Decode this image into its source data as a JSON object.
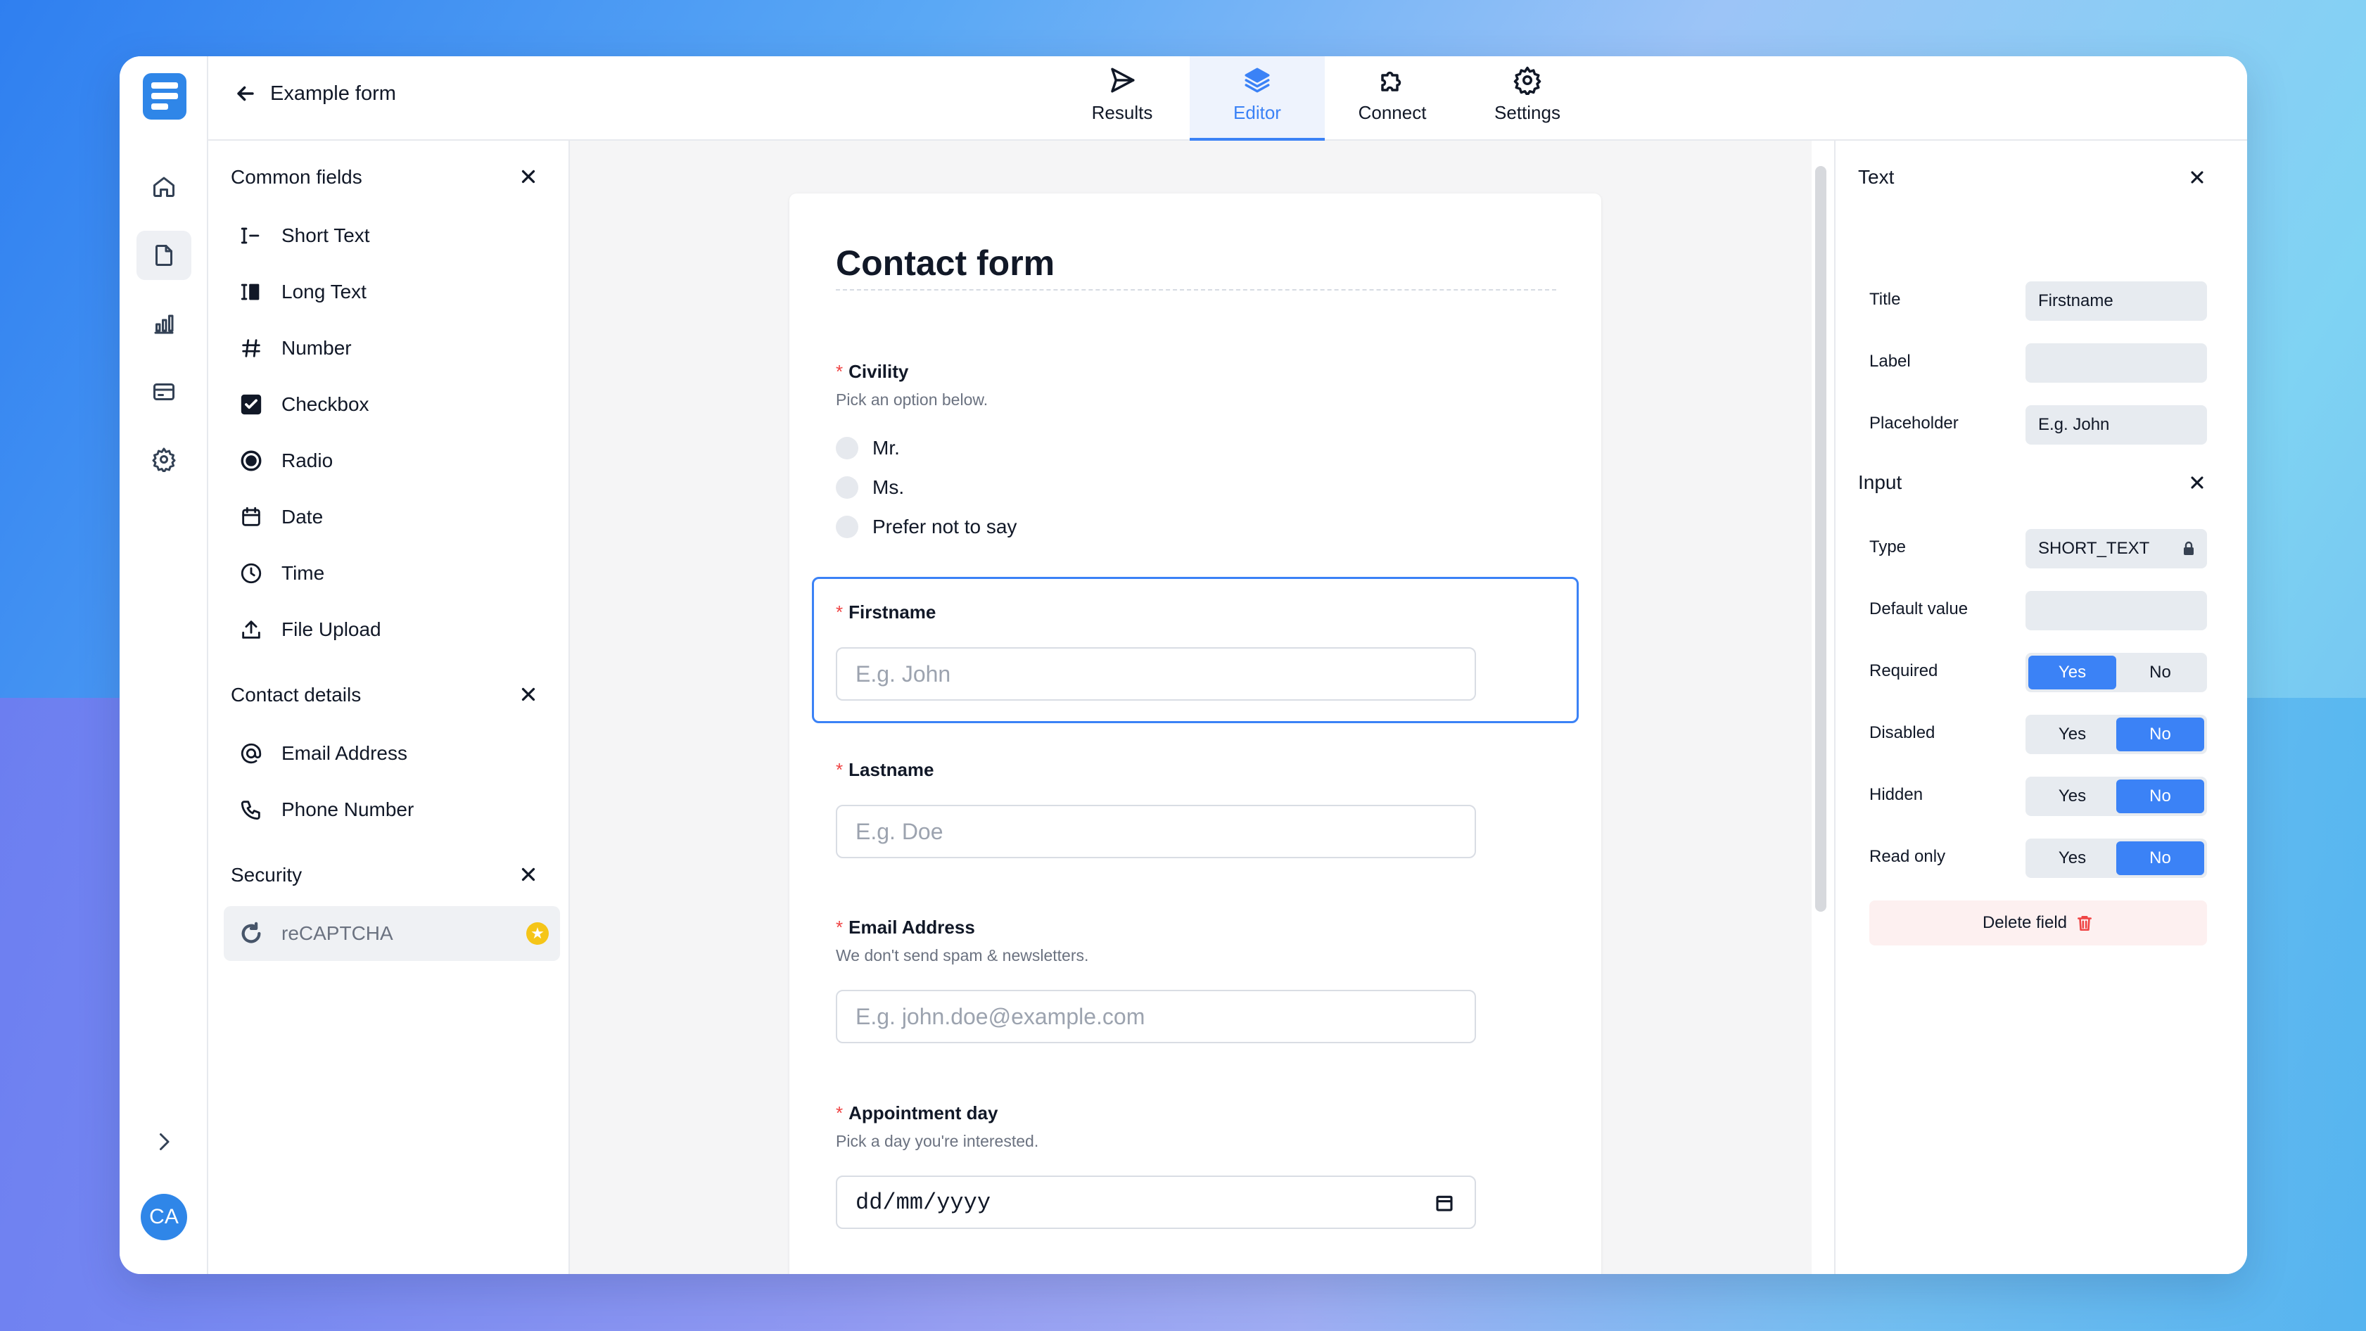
{
  "header": {
    "back_label": "Example form"
  },
  "tabs": [
    {
      "label": "Results",
      "icon": "send-icon"
    },
    {
      "label": "Editor",
      "icon": "layers-icon",
      "active": true
    },
    {
      "label": "Connect",
      "icon": "puzzle-icon"
    },
    {
      "label": "Settings",
      "icon": "gear-icon"
    }
  ],
  "rail": {
    "items": [
      "home-icon",
      "document-icon",
      "chart-icon",
      "card-icon",
      "gear-icon"
    ],
    "expand_icon": "chevron-right-icon",
    "avatar": "CA"
  },
  "fields_panel": {
    "sections": [
      {
        "title": "Common fields",
        "items": [
          "Short Text",
          "Long Text",
          "Number",
          "Checkbox",
          "Radio",
          "Date",
          "Time",
          "File Upload"
        ]
      },
      {
        "title": "Contact details",
        "items": [
          "Email Address",
          "Phone Number"
        ]
      },
      {
        "title": "Security",
        "items": [
          "reCAPTCHA"
        ]
      }
    ]
  },
  "form": {
    "title": "Contact form",
    "civility": {
      "label": "Civility",
      "help": "Pick an option below.",
      "options": [
        "Mr.",
        "Ms.",
        "Prefer not to say"
      ]
    },
    "firstname": {
      "label": "Firstname",
      "placeholder": "E.g. John"
    },
    "lastname": {
      "label": "Lastname",
      "placeholder": "E.g. Doe"
    },
    "email": {
      "label": "Email Address",
      "help": "We don't send spam & newsletters.",
      "placeholder": "E.g. john.doe@example.com"
    },
    "appointment": {
      "label": "Appointment day",
      "help": "Pick a day you're interested.",
      "value": "dd/mm/yyyy"
    },
    "required_mark": "*"
  },
  "props": {
    "text_section": "Text",
    "title_label": "Title",
    "title_value": "Firstname",
    "label_label": "Label",
    "label_value": "",
    "placeholder_label": "Placeholder",
    "placeholder_value": "E.g. John",
    "input_section": "Input",
    "type_label": "Type",
    "type_value": "SHORT_TEXT",
    "default_label": "Default value",
    "default_value": "",
    "required_label": "Required",
    "disabled_label": "Disabled",
    "hidden_label": "Hidden",
    "readonly_label": "Read only",
    "yes": "Yes",
    "no": "No",
    "required": "Yes",
    "disabled": "No",
    "hidden": "No",
    "readonly": "No",
    "delete_label": "Delete field"
  },
  "colors": {
    "accent": "#3b82f6",
    "required": "#ef4444",
    "premium_star": "#f5c518"
  }
}
